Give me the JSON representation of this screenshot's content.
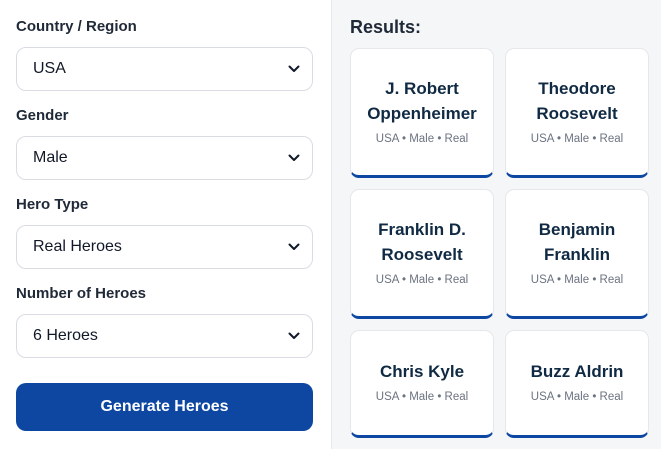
{
  "form": {
    "country": {
      "label": "Country / Region",
      "value": "USA"
    },
    "gender": {
      "label": "Gender",
      "value": "Male"
    },
    "hero_type": {
      "label": "Hero Type",
      "value": "Real Heroes"
    },
    "count": {
      "label": "Number of Heroes",
      "value": "6 Heroes"
    },
    "generate_label": "Generate Heroes"
  },
  "results": {
    "title": "Results:",
    "cards": [
      {
        "name": "J. Robert Oppenheimer",
        "meta": "USA • Male • Real"
      },
      {
        "name": "Theodore Roosevelt",
        "meta": "USA • Male • Real"
      },
      {
        "name": "Franklin D. Roosevelt",
        "meta": "USA • Male • Real"
      },
      {
        "name": "Benjamin Franklin",
        "meta": "USA • Male • Real"
      },
      {
        "name": "Chris Kyle",
        "meta": "USA • Male • Real"
      },
      {
        "name": "Buzz Aldrin",
        "meta": "USA • Male • Real"
      }
    ]
  },
  "colors": {
    "accent": "#0d47a1",
    "panel_bg": "#f5f6f8",
    "heading": "#102a43"
  },
  "icons": {
    "select_arrow": "chevron-down-icon"
  }
}
